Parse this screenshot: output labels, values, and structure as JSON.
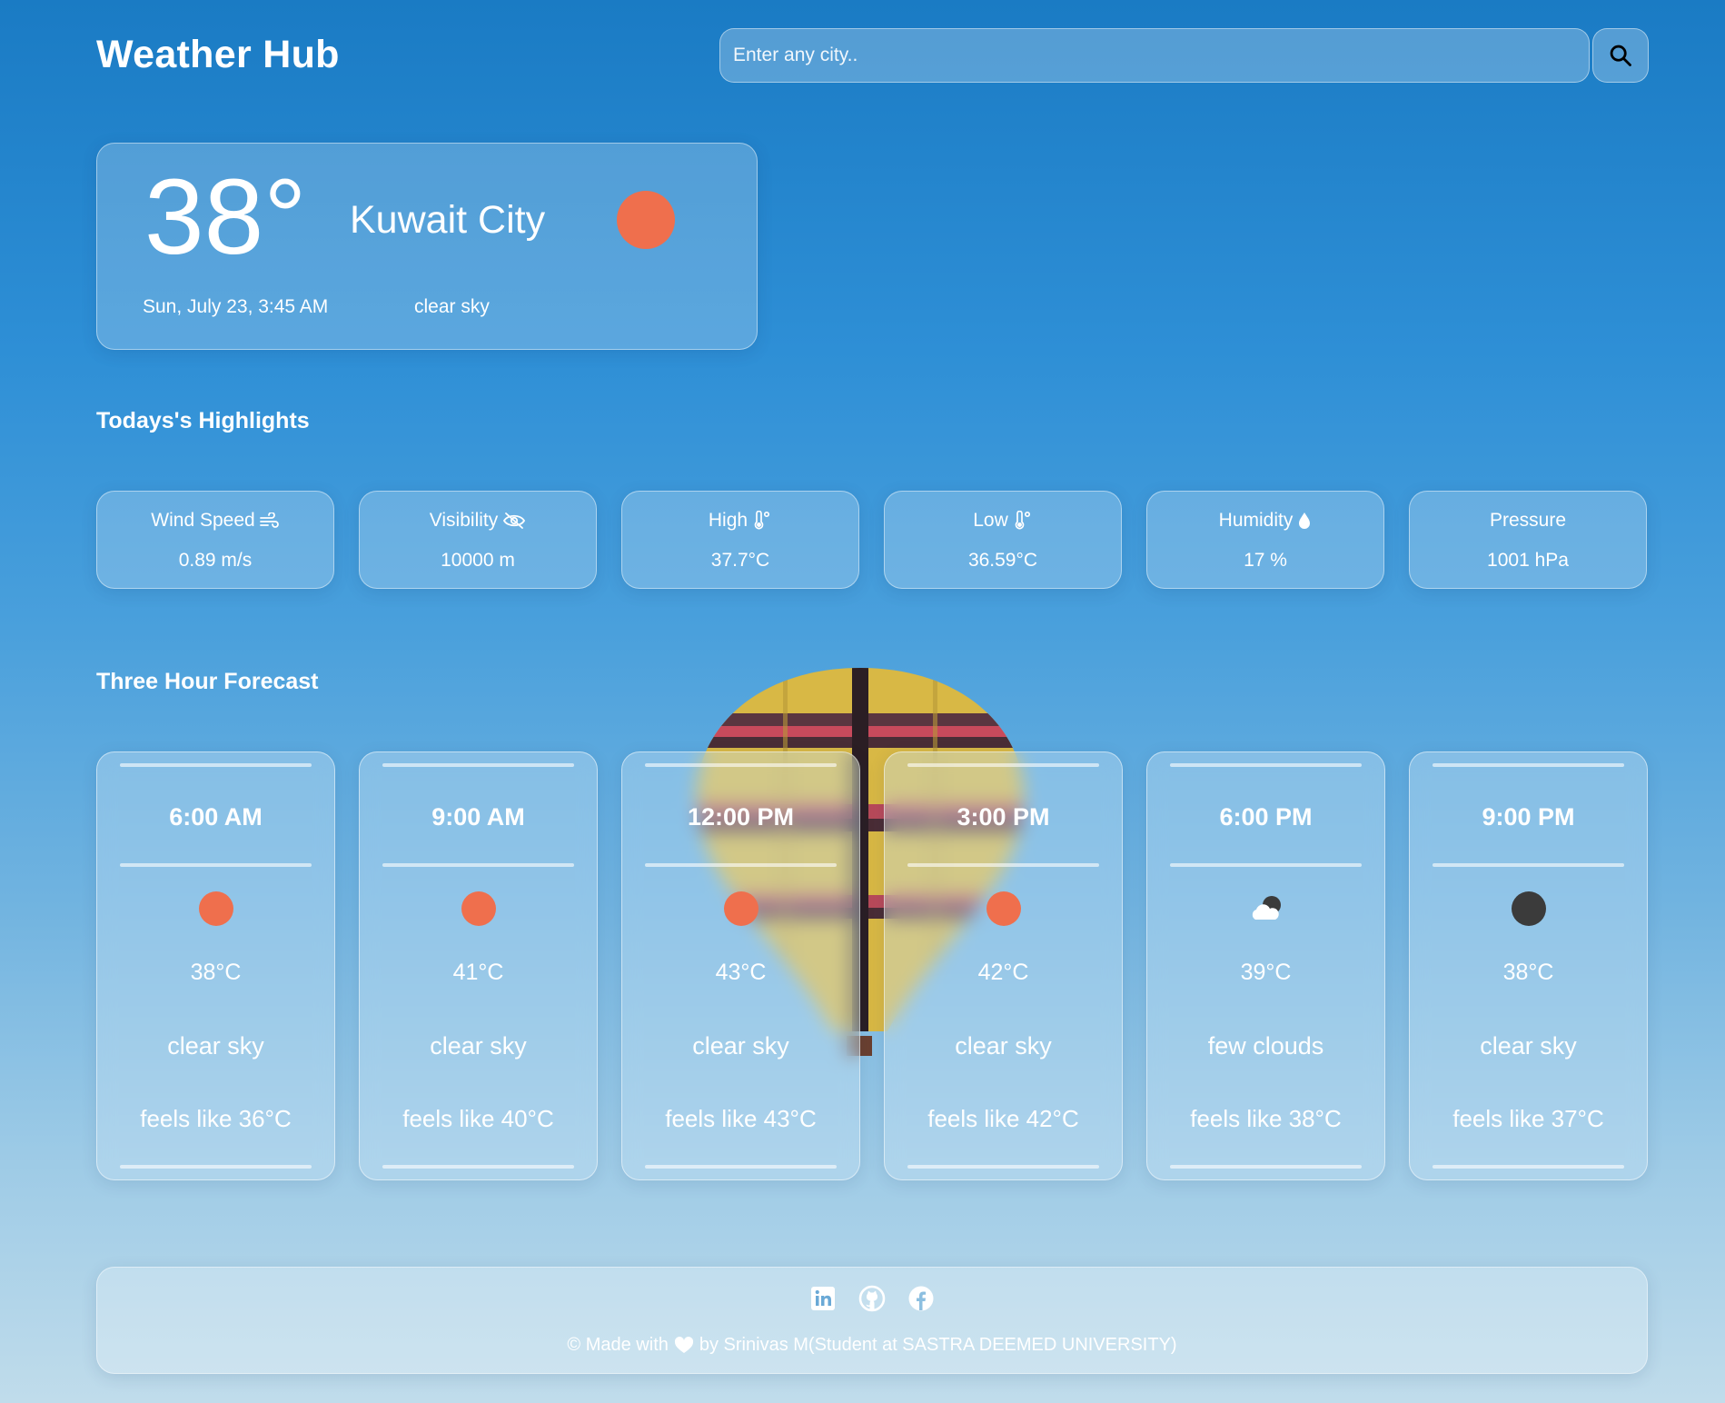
{
  "app": {
    "title": "Weather Hub"
  },
  "search": {
    "placeholder": "Enter any city..",
    "value": "",
    "button_icon": "search-icon"
  },
  "current": {
    "temperature": "38°",
    "city": "Kuwait City",
    "datetime": "Sun, July 23, 3:45 AM",
    "description": "clear sky",
    "icon": "sun-icon"
  },
  "highlights": {
    "title": "Todays's Highlights",
    "items": [
      {
        "label": "Wind Speed",
        "value": "0.89 m/s",
        "icon": "wind-icon"
      },
      {
        "label": "Visibility",
        "value": "10000 m",
        "icon": "eye-slash-icon"
      },
      {
        "label": "High",
        "value": "37.7°C",
        "icon": "thermometer-icon"
      },
      {
        "label": "Low",
        "value": "36.59°C",
        "icon": "thermometer-icon"
      },
      {
        "label": "Humidity",
        "value": "17 %",
        "icon": "droplet-icon"
      },
      {
        "label": "Pressure",
        "value": "1001 hPa",
        "icon": ""
      }
    ]
  },
  "forecast": {
    "title": "Three Hour Forecast",
    "items": [
      {
        "time": "6:00 AM",
        "temp": "38°C",
        "description": "clear sky",
        "feels_like": "feels like 36°C",
        "icon": "sun-icon"
      },
      {
        "time": "9:00 AM",
        "temp": "41°C",
        "description": "clear sky",
        "feels_like": "feels like 40°C",
        "icon": "sun-icon"
      },
      {
        "time": "12:00 PM",
        "temp": "43°C",
        "description": "clear sky",
        "feels_like": "feels like 43°C",
        "icon": "sun-icon"
      },
      {
        "time": "3:00 PM",
        "temp": "42°C",
        "description": "clear sky",
        "feels_like": "feels like 42°C",
        "icon": "sun-icon"
      },
      {
        "time": "6:00 PM",
        "temp": "39°C",
        "description": "few clouds",
        "feels_like": "feels like 38°C",
        "icon": "cloud-moon-icon"
      },
      {
        "time": "9:00 PM",
        "temp": "38°C",
        "description": "clear sky",
        "feels_like": "feels like 37°C",
        "icon": "moon-icon"
      }
    ]
  },
  "footer": {
    "credit_prefix": "© Made with",
    "credit_suffix": "by Srinivas M(Student at SASTRA DEEMED UNIVERSITY)",
    "social": [
      "linkedin-icon",
      "github-icon",
      "facebook-icon"
    ]
  },
  "colors": {
    "sun": "#ef6f4d",
    "moon": "#3b3b3b",
    "text": "#ffffff",
    "background_top": "#1a7bc4",
    "background_bottom": "#c0dceb"
  }
}
